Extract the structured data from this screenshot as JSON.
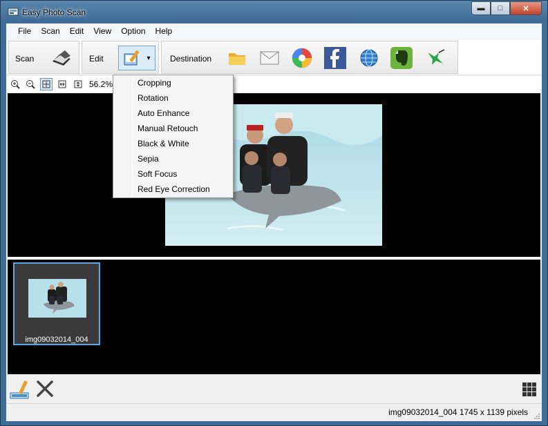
{
  "window": {
    "title": "Easy Photo Scan",
    "minimize": "▬",
    "maximize": "□",
    "close": "✕"
  },
  "menu": [
    "File",
    "Scan",
    "Edit",
    "View",
    "Option",
    "Help"
  ],
  "toolbar": {
    "scan_label": "Scan",
    "edit_label": "Edit",
    "edit_arrow": "▾",
    "destination_label": "Destination",
    "destinations": [
      "folder-icon",
      "mail-icon",
      "picasa-icon",
      "facebook-icon",
      "web-icon",
      "evernote-icon",
      "hummingbird-icon"
    ]
  },
  "zoom": {
    "value": "56.2%"
  },
  "edit_menu": [
    "Cropping",
    "Rotation",
    "Auto Enhance",
    "Manual Retouch",
    "Black & White",
    "Sepia",
    "Soft Focus",
    "Red Eye Correction"
  ],
  "thumbnail": {
    "label": "img09032014_004"
  },
  "status": {
    "text": "img09032014_004 1745 x 1139 pixels"
  },
  "colors": {
    "selection": "#5aa9e6",
    "facebook": "#3b5998",
    "evernote": "#6db33f"
  }
}
